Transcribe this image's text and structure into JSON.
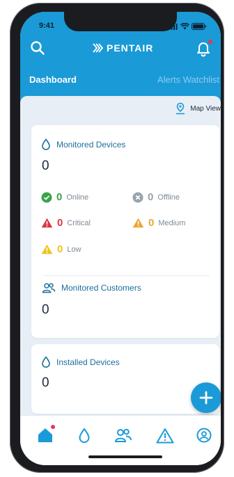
{
  "status_bar": {
    "time": "9:41"
  },
  "header": {
    "brand": "PENTAIR",
    "tabs": [
      {
        "label": "Dashboard",
        "active": true
      },
      {
        "label": "Alerts Watchlist",
        "active": false
      }
    ]
  },
  "map_view": {
    "label": "Map View"
  },
  "monitored_devices": {
    "title": "Monitored Devices",
    "count": "0",
    "stats": [
      {
        "name": "online",
        "value": "0",
        "label": "Online",
        "color": "#3aa34a"
      },
      {
        "name": "offline",
        "value": "0",
        "label": "Offline",
        "color": "#9aa3ab"
      },
      {
        "name": "critical",
        "value": "0",
        "label": "Critical",
        "color": "#d93545"
      },
      {
        "name": "medium",
        "value": "0",
        "label": "Medium",
        "color": "#e9a832"
      },
      {
        "name": "low",
        "value": "0",
        "label": "Low",
        "color": "#f2c21b"
      }
    ]
  },
  "monitored_customers": {
    "title": "Monitored Customers",
    "count": "0"
  },
  "installed_devices": {
    "title": "Installed Devices",
    "count": "0"
  },
  "colors": {
    "primary": "#1a9ad7",
    "alert_dot": "#e53950",
    "text_dark": "#1c2b3a"
  },
  "bottom_nav": [
    "home",
    "devices",
    "customers",
    "alerts",
    "profile"
  ]
}
